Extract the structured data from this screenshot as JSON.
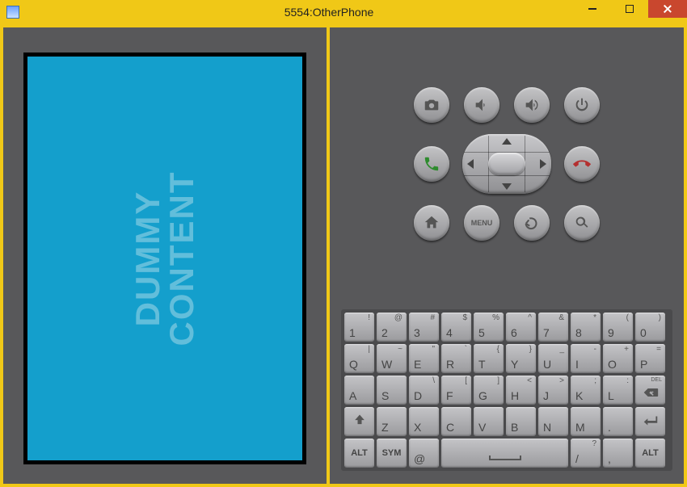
{
  "window": {
    "title": "5554:OtherPhone"
  },
  "screen": {
    "line1": "DUMMY",
    "line2": "CONTENT"
  },
  "buttons": {
    "menu": "MENU"
  },
  "keyboard": {
    "row1": [
      {
        "m": "1",
        "s": "!"
      },
      {
        "m": "2",
        "s": "@"
      },
      {
        "m": "3",
        "s": "#"
      },
      {
        "m": "4",
        "s": "$"
      },
      {
        "m": "5",
        "s": "%"
      },
      {
        "m": "6",
        "s": "^"
      },
      {
        "m": "7",
        "s": "&"
      },
      {
        "m": "8",
        "s": "*"
      },
      {
        "m": "9",
        "s": "("
      },
      {
        "m": "0",
        "s": ")"
      }
    ],
    "row2": [
      {
        "m": "Q",
        "s": "|"
      },
      {
        "m": "W",
        "s": "~"
      },
      {
        "m": "E",
        "s": "\""
      },
      {
        "m": "R",
        "s": "`"
      },
      {
        "m": "T",
        "s": "{"
      },
      {
        "m": "Y",
        "s": "}"
      },
      {
        "m": "U",
        "s": "_"
      },
      {
        "m": "I",
        "s": "-"
      },
      {
        "m": "O",
        "s": "+"
      },
      {
        "m": "P",
        "s": "="
      }
    ],
    "row3": [
      {
        "m": "A",
        "s": ""
      },
      {
        "m": "S",
        "s": ""
      },
      {
        "m": "D",
        "s": "\\"
      },
      {
        "m": "F",
        "s": "["
      },
      {
        "m": "G",
        "s": "]"
      },
      {
        "m": "H",
        "s": "<"
      },
      {
        "m": "J",
        "s": ">"
      },
      {
        "m": "K",
        "s": ";"
      },
      {
        "m": "L",
        "s": ":"
      }
    ],
    "row3_del": "DEL",
    "row4_keys": [
      "Z",
      "X",
      "C",
      "V",
      "B",
      "N",
      "M",
      "."
    ],
    "row5": {
      "alt": "ALT",
      "sym": "SYM",
      "at": "@",
      "slash": "/",
      "comma": ",",
      "question": "?"
    }
  }
}
